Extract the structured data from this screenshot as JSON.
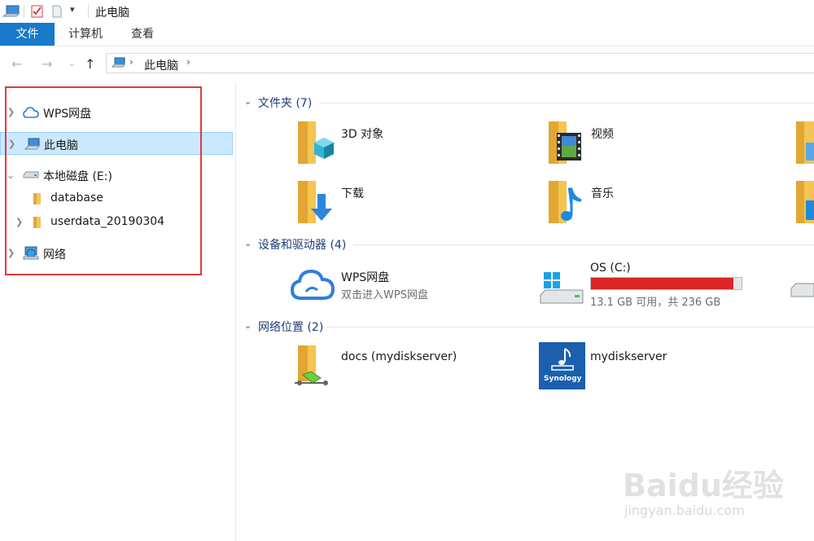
{
  "window": {
    "title": "此电脑"
  },
  "ribbon": {
    "tabs": [
      "文件",
      "计算机",
      "查看"
    ]
  },
  "address": {
    "path_label": "此电脑"
  },
  "sidebar": {
    "items": [
      {
        "label": "WPS网盘",
        "icon": "cloud-icon",
        "expandable": true
      },
      {
        "label": "此电脑",
        "icon": "computer-icon",
        "expandable": true,
        "selected": true
      },
      {
        "label": "本地磁盘 (E:)",
        "icon": "drive-icon",
        "expanded": true
      },
      {
        "label": "database",
        "icon": "folder-icon"
      },
      {
        "label": "userdata_20190304",
        "icon": "folder-icon",
        "expandable": true
      },
      {
        "label": "网络",
        "icon": "network-icon",
        "expandable": true
      }
    ]
  },
  "groups": {
    "folders": {
      "header": "文件夹 (7)",
      "items": [
        {
          "label": "3D 对象",
          "icon": "3d-objects-folder-icon"
        },
        {
          "label": "视频",
          "icon": "videos-folder-icon"
        },
        {
          "label": "下载",
          "icon": "downloads-folder-icon"
        },
        {
          "label": "音乐",
          "icon": "music-folder-icon"
        }
      ]
    },
    "devices": {
      "header": "设备和驱动器 (4)",
      "items": [
        {
          "label": "WPS网盘",
          "sublabel": "双击进入WPS网盘",
          "icon": "cloud-icon"
        },
        {
          "label": "OS (C:)",
          "sublabel": "13.1 GB 可用，共 236 GB",
          "icon": "windows-drive-icon",
          "used_fraction": 0.944,
          "bar_color": "#da2626"
        }
      ]
    },
    "network": {
      "header": "网络位置 (2)",
      "items": [
        {
          "label": "docs (mydiskserver)",
          "icon": "network-folder-icon"
        },
        {
          "label": "mydiskserver",
          "icon": "synology-icon",
          "logo_text": "Synology"
        }
      ]
    }
  },
  "colors": {
    "accent": "#1979ca",
    "selection": "#cce8ff",
    "highlight_box": "#e03a3a"
  },
  "watermark": {
    "text": "Baidu经验",
    "url_text": "jingyan.baidu.com"
  }
}
